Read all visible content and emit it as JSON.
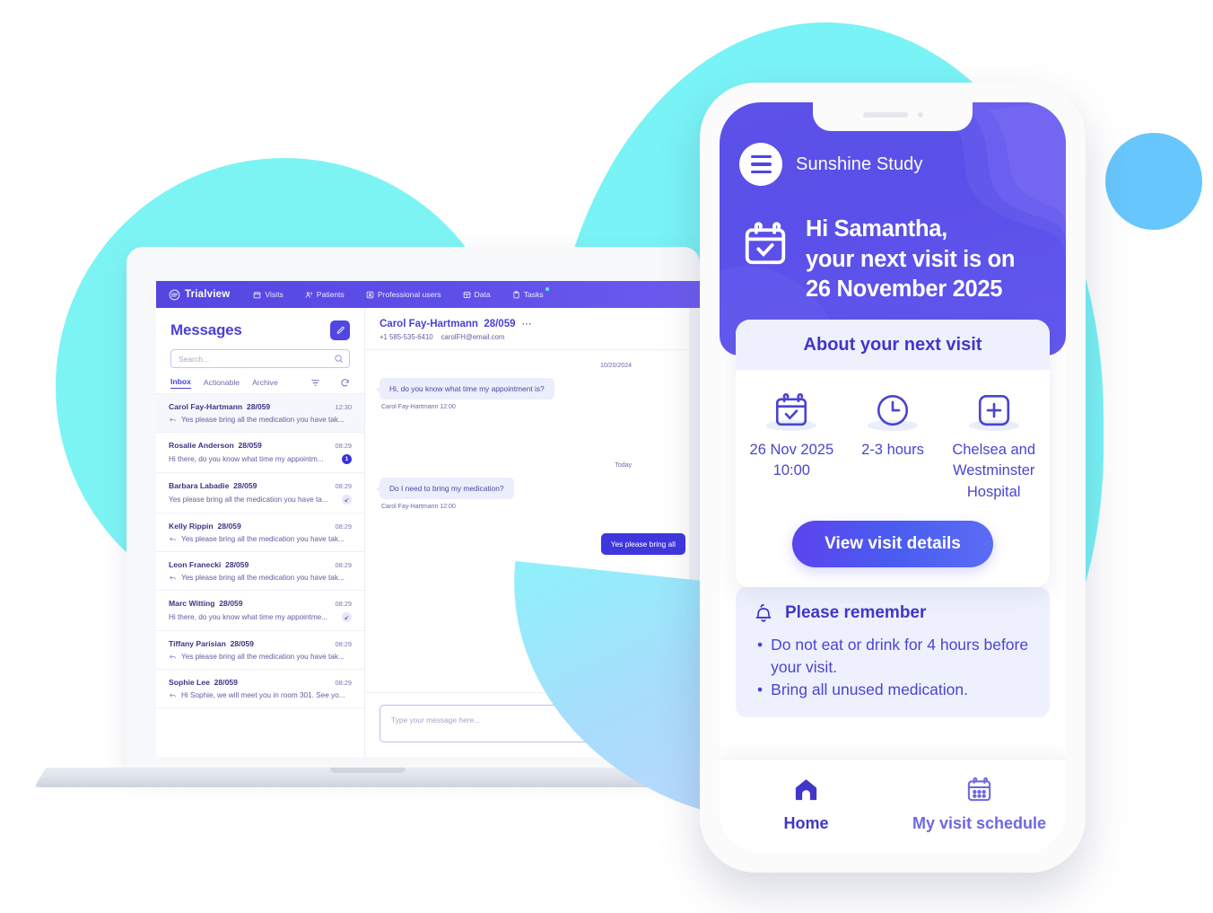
{
  "laptop": {
    "topnav": {
      "brand": "Trialview",
      "items": [
        {
          "label": "Visits",
          "icon": "calendar-icon"
        },
        {
          "label": "Patients",
          "icon": "people-icon"
        },
        {
          "label": "Professional users",
          "icon": "badge-icon"
        },
        {
          "label": "Data",
          "icon": "table-icon"
        },
        {
          "label": "Tasks",
          "icon": "clipboard-icon"
        }
      ]
    },
    "messages": {
      "title": "Messages",
      "compose_icon": "compose-icon",
      "search": {
        "placeholder": "Search...",
        "value": "",
        "icon": "search-icon"
      },
      "tabs": [
        {
          "label": "Inbox",
          "active": true
        },
        {
          "label": "Actionable",
          "active": false
        },
        {
          "label": "Archive",
          "active": false
        }
      ],
      "filter_icon": "filter-icon",
      "refresh_icon": "refresh-icon",
      "rows": [
        {
          "name": "Carol Fay-Hartmann",
          "code": "28/059",
          "time": "12:30",
          "preview": "Yes please bring all the medication you have tak...",
          "reply": true,
          "badge": "",
          "selected": true
        },
        {
          "name": "Rosalie Anderson",
          "code": "28/059",
          "time": "08:29",
          "preview": "Hi there, do you know what time my appointm...",
          "reply": false,
          "badge": "1",
          "selected": false
        },
        {
          "name": "Barbara Labadie",
          "code": "28/059",
          "time": "08:29",
          "preview": "Yes please bring all the medication you have ta...",
          "reply": false,
          "badge": "arrow",
          "selected": false
        },
        {
          "name": "Kelly Rippin",
          "code": "28/059",
          "time": "08:29",
          "preview": "Yes please bring all the medication you have tak...",
          "reply": true,
          "badge": "",
          "selected": false
        },
        {
          "name": "Leon Franecki",
          "code": "28/059",
          "time": "08:29",
          "preview": "Yes please bring all the medication you have tak...",
          "reply": true,
          "badge": "",
          "selected": false
        },
        {
          "name": "Marc Witting",
          "code": "28/059",
          "time": "08:29",
          "preview": "Hi there, do you know what time my appointme...",
          "reply": false,
          "badge": "arrow",
          "selected": false
        },
        {
          "name": "Tiffany Parisian",
          "code": "28/059",
          "time": "08:29",
          "preview": "Yes please bring all the medication you have tak...",
          "reply": true,
          "badge": "",
          "selected": false
        },
        {
          "name": "Sophie Lee",
          "code": "28/059",
          "time": "08:29",
          "preview": "Hi Sophie, we will meet you in room 301. See yo...",
          "reply": true,
          "badge": "",
          "selected": false
        }
      ]
    },
    "thread": {
      "name": "Carol Fay-Hartmann",
      "code": "28/059",
      "more_icon": "more-icon",
      "phone": "+1 585-535-6410",
      "email": "carolFH@email.com",
      "date_sep_1": "10/20/2024",
      "msg1": "Hi, do you know what time my appointment is?",
      "msg1_meta": "Carol Fay-Hartmann  12:00",
      "date_sep_2": "Today",
      "msg2": "Do I need to bring my medication?",
      "msg2_meta": "Carol Fay-Hartmann  12:00",
      "msg3_out": "Yes please bring all",
      "composer_placeholder": "Type your message here..."
    }
  },
  "phone": {
    "menu_icon": "hamburger-icon",
    "study_name": "Sunshine Study",
    "hero_icon": "calendar-check-icon",
    "hero_title": "Hi Samantha,\nyour next visit is on\n26 November 2025",
    "card": {
      "heading": "About your next visit",
      "columns": [
        {
          "icon": "calendar-check-icon",
          "label": "26 Nov 2025\n10:00"
        },
        {
          "icon": "clock-icon",
          "label": "2-3 hours"
        },
        {
          "icon": "hospital-icon",
          "label": "Chelsea and Westminster Hospital"
        }
      ],
      "cta_label": "View visit details"
    },
    "remember": {
      "icon": "bell-icon",
      "title": "Please remember",
      "items": [
        "Do not eat or drink for 4 hours before your visit.",
        "Bring all unused medication."
      ]
    },
    "tabbar": [
      {
        "icon": "home-icon",
        "label": "Home",
        "active": true
      },
      {
        "icon": "calendar-grid-icon",
        "label": "My visit schedule",
        "active": false
      }
    ]
  },
  "colors": {
    "brand_purple": "#4f45e4",
    "deep_purple": "#4136c9",
    "accent_cyan": "#7df4f4",
    "bubble_in": "#eceefb",
    "bubble_out": "#4036dd"
  }
}
